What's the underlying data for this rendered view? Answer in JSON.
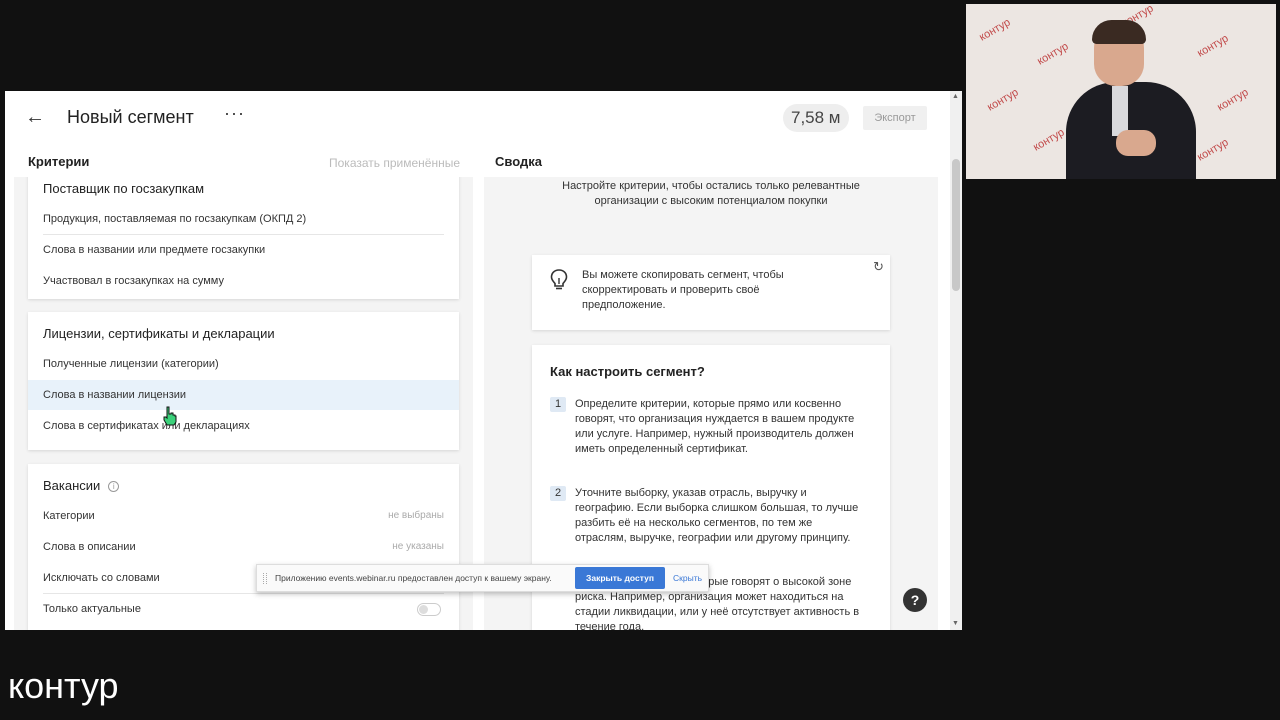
{
  "header": {
    "title": "Новый сегмент",
    "more": "···",
    "count": "7,58 м",
    "export": "Экспорт"
  },
  "criteria": {
    "heading": "Критерии",
    "show_applied": "Показать применённые",
    "sections": [
      {
        "title": "Поставщик по госзакупкам",
        "rows": [
          {
            "label": "Продукция, поставляемая по госзакупкам (ОКПД 2)"
          },
          {
            "label": "Слова в названии или предмете госзакупки"
          },
          {
            "label": "Участвовал в госзакупках на сумму"
          }
        ]
      },
      {
        "title": "Лицензии, сертификаты и декларации",
        "rows": [
          {
            "label": "Полученные лицензии (категории)"
          },
          {
            "label": "Слова в названии лицензии"
          },
          {
            "label": "Слова в сертификатах или декларациях"
          }
        ]
      },
      {
        "title": "Вакансии",
        "rows": [
          {
            "label": "Категории",
            "value": "не выбраны"
          },
          {
            "label": "Слова в описании",
            "value": "не указаны"
          },
          {
            "label": "Исключать со словами",
            "value": ""
          },
          {
            "label": "Только актуальные",
            "value": ""
          }
        ]
      }
    ]
  },
  "summary": {
    "heading": "Сводка",
    "intro_line1": "Настройте критерии, чтобы остались только релевантные",
    "intro_line2": "организации с высоким потенциалом покупки",
    "tip": "Вы можете скопировать сегмент, чтобы скорректировать и проверить своё предположение.",
    "howto_title": "Как настроить сегмент?",
    "steps": [
      {
        "num": "1",
        "text": "Определите критерии, которые прямо или косвенно говорят, что организация нуждается в вашем продукте или услуге. Например, нужный производитель должен иметь определенный сертификат."
      },
      {
        "num": "2",
        "text": "Уточните выборку, указав отрасль, выручку и географию. Если выборка слишком большая, то лучше разбить её на несколько сегментов, по тем же отраслям, выручке, географии или другому принципу."
      },
      {
        "num": "3",
        "text": "Исключите критерии, которые говорят о высокой зоне риска. Например, организация может находиться на стадии ликвидации, или у неё отсутствует активность в течение года."
      }
    ]
  },
  "help": "?",
  "share_bar": {
    "text": "Приложению events.webinar.ru предоставлен доступ к вашему экрану.",
    "close_label": "Закрыть доступ",
    "hide_label": "Скрыть"
  },
  "webcam": {
    "watermark": "контур"
  },
  "logo": {
    "text": "контур"
  }
}
